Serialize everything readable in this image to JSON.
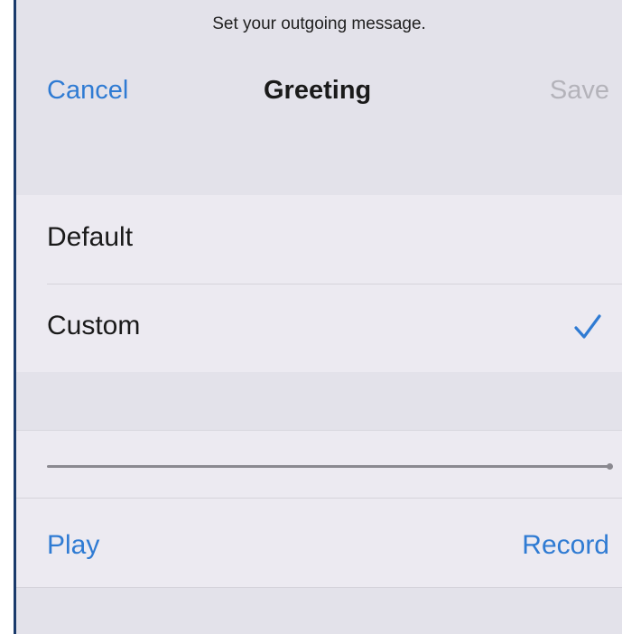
{
  "header": {
    "instruction": "Set your outgoing message."
  },
  "nav": {
    "cancel_label": "Cancel",
    "title": "Greeting",
    "save_label": "Save"
  },
  "options": {
    "items": [
      {
        "label": "Default",
        "selected": false
      },
      {
        "label": "Custom",
        "selected": true
      }
    ]
  },
  "playback": {
    "progress": 1.0,
    "play_label": "Play",
    "record_label": "Record"
  },
  "icons": {
    "selected_indicator": "checkmark-icon"
  },
  "colors": {
    "accent": "#2f7bd3",
    "disabled": "#b4b3ba",
    "background": "#e3e2ea",
    "cell": "#eceaf1"
  }
}
